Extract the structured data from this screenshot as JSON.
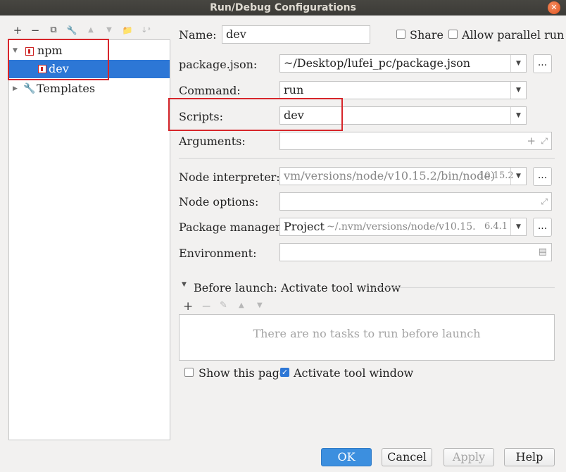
{
  "window": {
    "title": "Run/Debug Configurations",
    "close_glyph": "✕"
  },
  "toolbar": {
    "add": "+",
    "remove": "−",
    "copy": "⧉",
    "edit": "🔧",
    "move_up": "▲",
    "move_down": "▼",
    "folder": "📁",
    "sort": "↓ᵃ"
  },
  "tree": {
    "group_label": "npm",
    "child_label": "dev",
    "templates_label": "Templates"
  },
  "form": {
    "name_label": "Name:",
    "name_value": "dev",
    "share_label": "Share",
    "allow_parallel_label": "Allow parallel run",
    "package_json_label": "package.json:",
    "package_json_value": "~/Desktop/lufei_pc/package.json",
    "command_label": "Command:",
    "command_value": "run",
    "scripts_label": "Scripts:",
    "scripts_value": "dev",
    "arguments_label": "Arguments:",
    "node_interpreter_label": "Node interpreter:",
    "node_interpreter_value": "vm/versions/node/v10.15.2/bin/node)",
    "node_interpreter_version": "10.15.2",
    "node_options_label": "Node options:",
    "package_manager_label": "Package manager:",
    "package_manager_value": "Project",
    "package_manager_path": "~/.nvm/versions/node/v10.15.",
    "package_manager_version": "6.4.1",
    "environment_label": "Environment:",
    "dots": "..."
  },
  "before_launch": {
    "title": "Before launch: Activate tool window",
    "empty_text": "There are no tasks to run before launch",
    "show_page_label": "Show this page",
    "activate_tool_label": "Activate tool window"
  },
  "buttons": {
    "ok": "OK",
    "cancel": "Cancel",
    "apply": "Apply",
    "help": "Help"
  },
  "colors": {
    "selection": "#2d77d6",
    "highlight_box": "#d7262b",
    "ok_button": "#3c8fdf"
  }
}
